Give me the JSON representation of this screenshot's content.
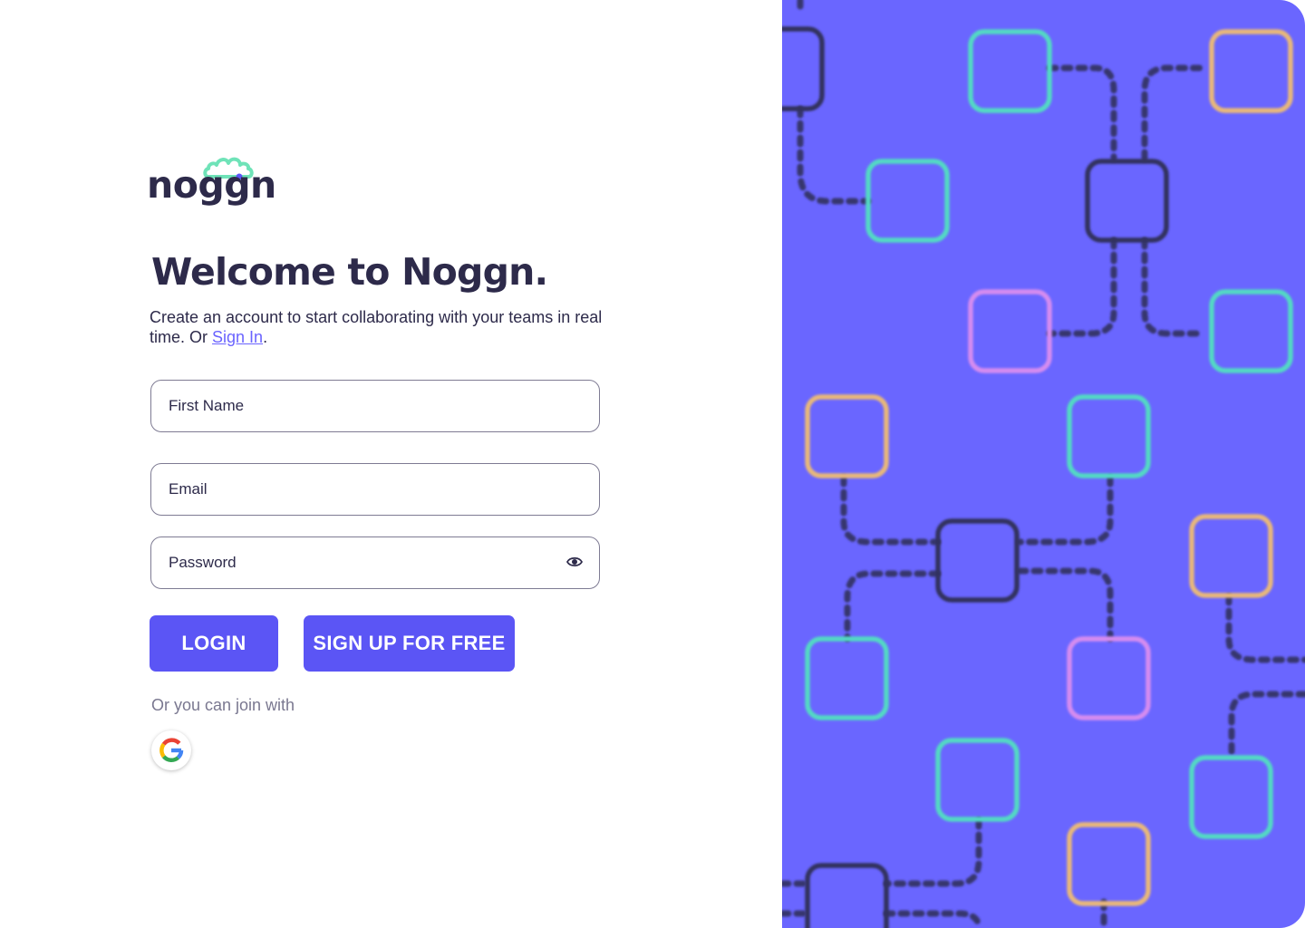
{
  "brand": {
    "name": "noggn",
    "accent": "#5b55f5",
    "cloud_color": "#6fe3b8"
  },
  "heading": "Welcome to Noggn.",
  "subtitle": {
    "text": "Create an account to start collaborating with your teams in real time. Or ",
    "link": "Sign In",
    "end": "."
  },
  "form": {
    "first_name_placeholder": "First Name",
    "email_placeholder": "Email",
    "password_placeholder": "Password",
    "password_toggle_icon": "eye-icon"
  },
  "buttons": {
    "login": "LOGIN",
    "signup": "SIGN UP FOR FREE"
  },
  "social": {
    "prompt": "Or you can join with",
    "providers": [
      "google"
    ]
  },
  "panel": {
    "background": "#6a66ff",
    "tile_colors": {
      "teal": "#52d9c4",
      "amber": "#e8b87a",
      "pink": "#d58cf0",
      "dark": "#33325e"
    }
  }
}
